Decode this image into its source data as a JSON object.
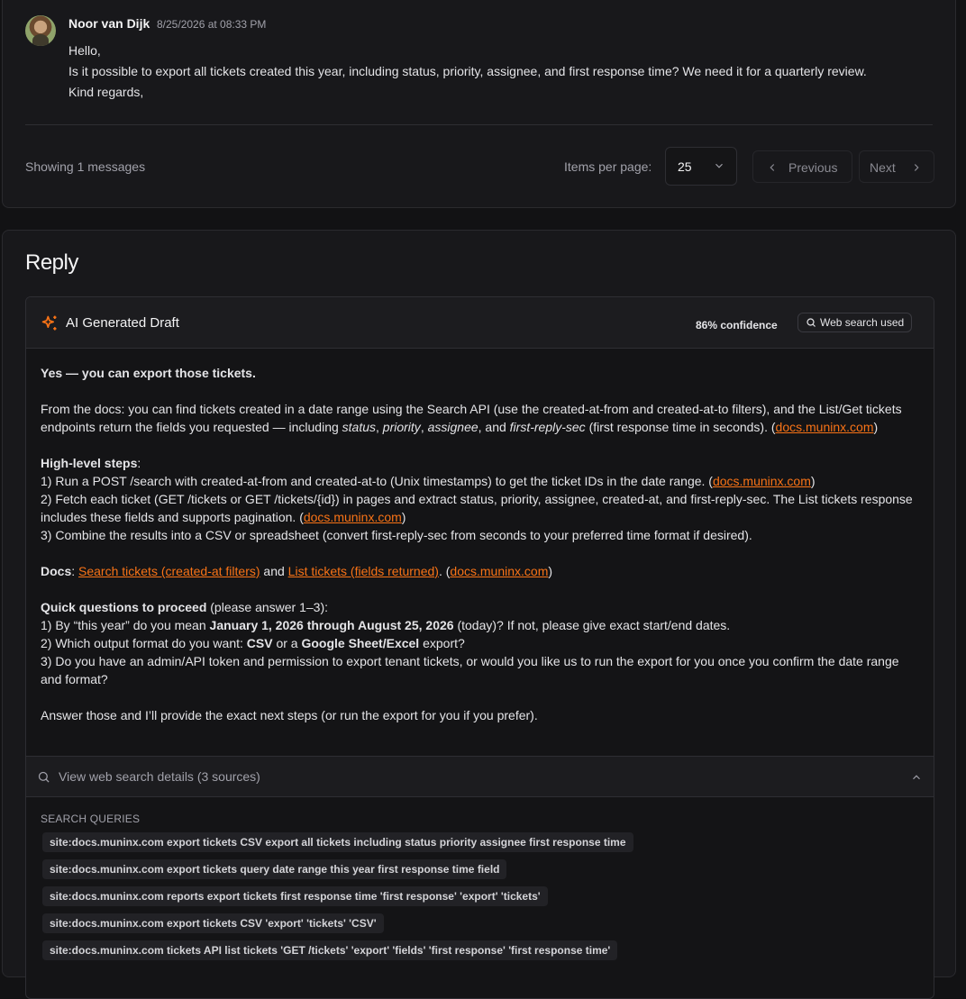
{
  "message": {
    "author": "Noor van Dijk",
    "timestamp": "8/25/2026 at 08:33 PM",
    "lines": [
      "Hello,",
      "Is it possible to export all tickets created this year, including status, priority, assignee, and first response time? We need it for a quarterly review.",
      "Kind regards,"
    ]
  },
  "pagination": {
    "showing": "Showing 1 messages",
    "items_per_page_label": "Items per page:",
    "items_per_page_value": "25",
    "previous": "Previous",
    "next": "Next"
  },
  "reply": {
    "title": "Reply",
    "draft": {
      "title": "AI Generated Draft",
      "confidence": "86% confidence",
      "web_search": "Web search used",
      "p1": "Yes — you can export those tickets.",
      "p2_a": "From the docs: you can find tickets created in a date range using the Search API (use the created-at-from and created-at-to filters), and the List/Get tickets endpoints return the fields you requested — including ",
      "p2_status": "status",
      "p2_comma1": ", ",
      "p2_priority": "priority",
      "p2_comma2": ", ",
      "p2_assignee": "assignee",
      "p2_and": ", and ",
      "p2_frs": "first-reply-sec",
      "p2_b": " (first response time in seconds). (",
      "link_docs": "docs.muninx.com",
      "close_paren": ")",
      "steps_heading": "High-level steps",
      "colon": ":",
      "step1": "1) Run a POST /search with created-at-from and created-at-to (Unix timestamps) to get the ticket IDs in the date range. (",
      "step2": "2) Fetch each ticket (GET /tickets or GET /tickets/{id}) in pages and extract status, priority, assignee, created-at, and first-reply-sec. The List tickets response includes these fields and supports pagination. (",
      "step3": "3) Combine the results into a CSV or spreadsheet (convert first-reply-sec from seconds to your preferred time format if desired).",
      "docs_label": "Docs",
      "docs_link1": "Search tickets (created-at filters)",
      "docs_and": " and ",
      "docs_link2": "List tickets (fields returned)",
      "docs_tail": ". (",
      "qq_heading": "Quick questions to proceed",
      "qq_tail": " (please answer 1–3):",
      "q1_a": "1) By “this year” do you mean ",
      "q1_b": "January 1, 2026 through August 25, 2026",
      "q1_c": " (today)? If not, please give exact start/end dates.",
      "q2_a": "2) Which output format do you want: ",
      "q2_csv": "CSV",
      "q2_or": " or a ",
      "q2_gs": "Google Sheet/Excel",
      "q2_c": " export?",
      "q3": "3) Do you have an admin/API token and permission to export tenant tickets, or would you like us to run the export for you once you confirm the date range and format?",
      "closing": "Answer those and I’ll provide the exact next steps (or run the export for you if you prefer)."
    },
    "sources": {
      "label": "View web search details (3 sources)",
      "queries_heading": "SEARCH QUERIES",
      "queries": [
        "site:docs.muninx.com export tickets CSV export all tickets including status priority assignee first response time",
        "site:docs.muninx.com export tickets query date range this year first response time field",
        "site:docs.muninx.com reports export tickets first response time 'first response' 'export' 'tickets'",
        "site:docs.muninx.com export tickets CSV 'export' 'tickets' 'CSV'",
        "site:docs.muninx.com tickets API list tickets 'GET /tickets' 'export' 'fields' 'first response' 'first response time'"
      ]
    }
  },
  "colors": {
    "accent": "#f97316",
    "background": "#121214",
    "card": "#18181b"
  },
  "icons": [
    "sparkle-icon",
    "search-icon",
    "chevron-down-icon",
    "chevron-left-icon",
    "chevron-right-icon",
    "chevron-up-icon"
  ]
}
